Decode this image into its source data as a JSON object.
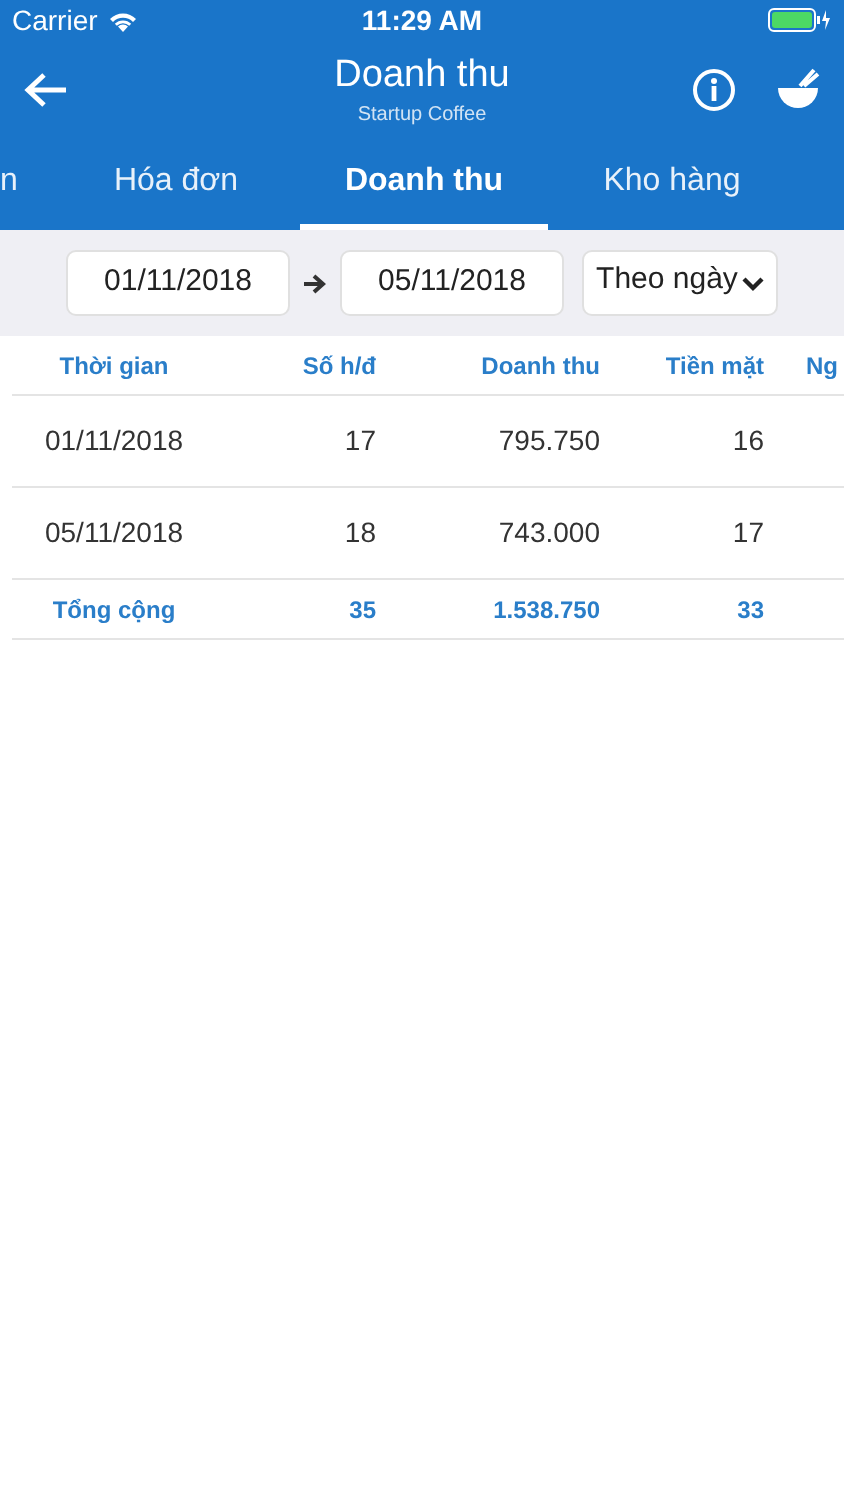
{
  "status_bar": {
    "carrier": "Carrier",
    "time": "11:29 AM"
  },
  "nav": {
    "title": "Doanh thu",
    "subtitle": "Startup Coffee"
  },
  "tabs": [
    {
      "label": "n",
      "selected": false
    },
    {
      "label": "Hóa đơn",
      "selected": false
    },
    {
      "label": "Doanh thu",
      "selected": true
    },
    {
      "label": "Kho hàng",
      "selected": false
    }
  ],
  "filter": {
    "from": "01/11/2018",
    "to": "05/11/2018",
    "period": "Theo ngày"
  },
  "table": {
    "columns": [
      "Thời gian",
      "Số h/đ",
      "Doanh thu",
      "Tiền mặt",
      "Ng"
    ],
    "rows": [
      [
        "01/11/2018",
        "17",
        "795.750",
        "16"
      ],
      [
        "05/11/2018",
        "18",
        "743.000",
        "17"
      ]
    ],
    "total": [
      "Tổng cộng",
      "35",
      "1.538.750",
      "33"
    ]
  }
}
